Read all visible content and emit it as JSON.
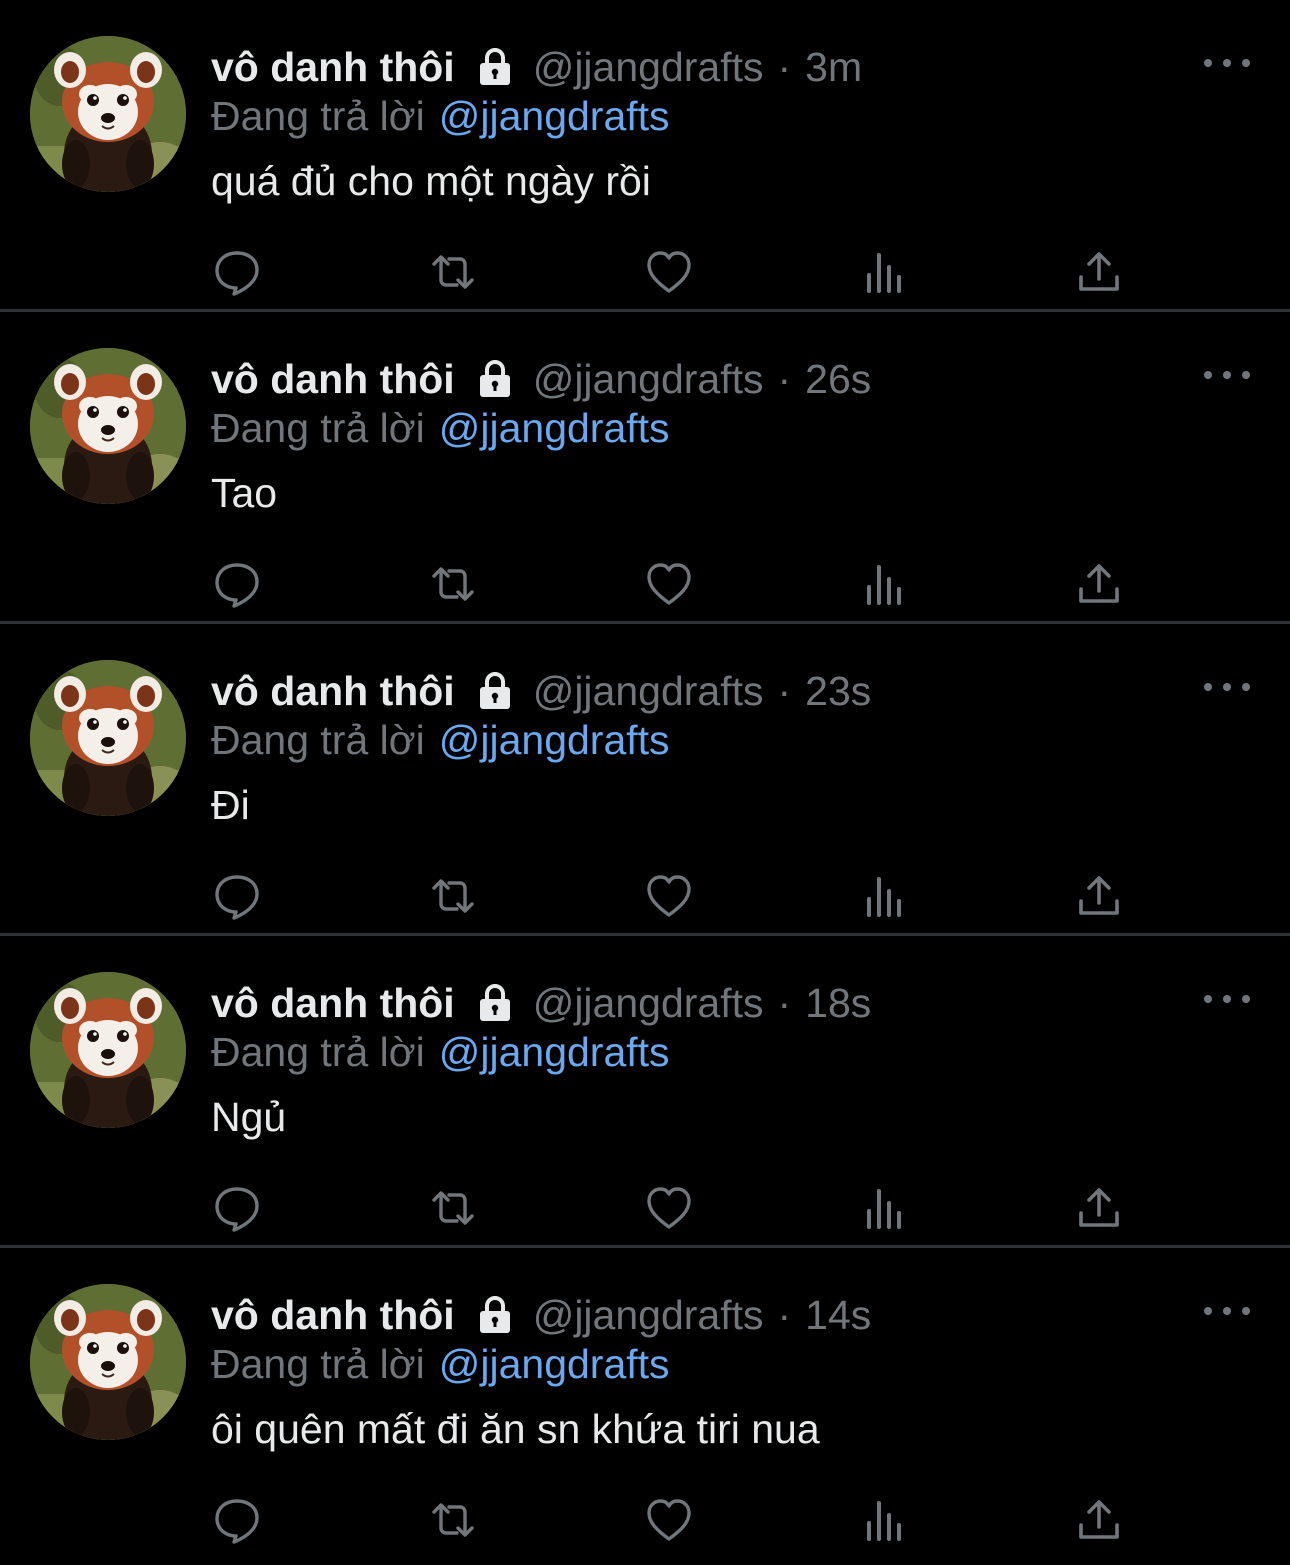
{
  "colors": {
    "background": "#000000",
    "text_primary": "#e7e9ea",
    "text_secondary": "#71767b",
    "link": "#6aa8f0",
    "divider": "#2f3336"
  },
  "tweets": [
    {
      "display_name": "vô danh thôi",
      "handle": "@jjangdrafts",
      "separator": "·",
      "time": "3m",
      "reply_prefix": "Đang trả lời",
      "reply_to": "@jjangdrafts",
      "text": "quá đủ cho một ngày rồi",
      "icons": {
        "avatar": "red-panda-avatar",
        "lock": "lock-icon",
        "more": "more-icon",
        "reply": "reply-icon",
        "retweet": "retweet-icon",
        "like": "like-icon",
        "views": "views-icon",
        "share": "share-icon"
      }
    },
    {
      "display_name": "vô danh thôi",
      "handle": "@jjangdrafts",
      "separator": "·",
      "time": "26s",
      "reply_prefix": "Đang trả lời",
      "reply_to": "@jjangdrafts",
      "text": "Tao"
    },
    {
      "display_name": "vô danh thôi",
      "handle": "@jjangdrafts",
      "separator": "·",
      "time": "23s",
      "reply_prefix": "Đang trả lời",
      "reply_to": "@jjangdrafts",
      "text": "Đi"
    },
    {
      "display_name": "vô danh thôi",
      "handle": "@jjangdrafts",
      "separator": "·",
      "time": "18s",
      "reply_prefix": "Đang trả lời",
      "reply_to": "@jjangdrafts",
      "text": "Ngủ"
    },
    {
      "display_name": "vô danh thôi",
      "handle": "@jjangdrafts",
      "separator": "·",
      "time": "14s",
      "reply_prefix": "Đang trả lời",
      "reply_to": "@jjangdrafts",
      "text": "ôi quên mất đi ăn sn khứa tiri nua"
    }
  ]
}
